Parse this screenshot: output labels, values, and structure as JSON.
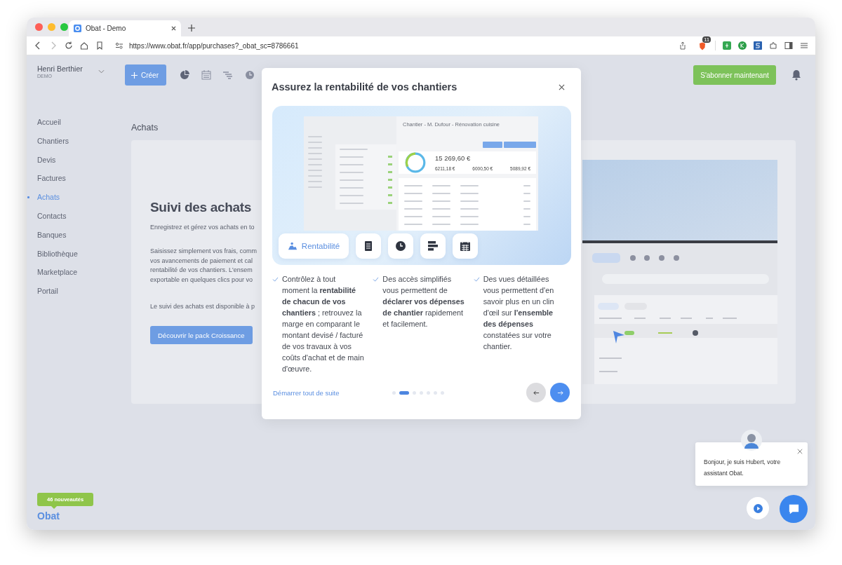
{
  "browser": {
    "tab_title": "Obat - Demo",
    "url": "https://www.obat.fr/app/purchases?_obat_sc=8786661",
    "extension_badge": "11"
  },
  "user": {
    "name": "Henri Berthier",
    "org": "DEMO"
  },
  "create_button": "Créer",
  "subscribe_button": "S'abonner maintenant",
  "sidebar": {
    "items": [
      {
        "label": "Accueil",
        "selected": false
      },
      {
        "label": "Chantiers",
        "selected": false
      },
      {
        "label": "Devis",
        "selected": false
      },
      {
        "label": "Factures",
        "selected": false
      },
      {
        "label": "Achats",
        "selected": true
      },
      {
        "label": "Contacts",
        "selected": false
      },
      {
        "label": "Banques",
        "selected": false
      },
      {
        "label": "Bibliothèque",
        "selected": false
      },
      {
        "label": "Marketplace",
        "selected": false
      },
      {
        "label": "Portail",
        "selected": false
      }
    ],
    "news_badge": "46 nouveautés",
    "logo": "Obat"
  },
  "page": {
    "title": "Achats",
    "heading": "Suivi des achats",
    "subtitle": "Enregistrez et gérez vos achats en to",
    "body_lines": [
      "Saisissez simplement vos frais, comm",
      "vos avancements de paiement et cal",
      "rentabilité de vos chantiers. L'ensem",
      "exportable en quelques clics pour vo"
    ],
    "availability": "Le suivi des achats est disponible à p",
    "cta": "Découvrir le pack Croissance"
  },
  "modal": {
    "title": "Assurez la rentabilité de vos chantiers",
    "preview": {
      "title": "Chantier - M. Dufour - Rénovation cuisine",
      "total": "15 269,60 €",
      "amounts": [
        "6211,18 €",
        "6000,50 €",
        "5089,92 €"
      ]
    },
    "feature_tabs": [
      {
        "label": "Rentabilité",
        "selected": true
      },
      {
        "selected": false
      },
      {
        "selected": false
      },
      {
        "selected": false
      },
      {
        "selected": false
      }
    ],
    "points": [
      "Contrôlez à tout moment la **rentabilité de chacun de vos chantiers** ; retrouvez la marge en comparant le montant devisé / facturé de vos travaux à vos coûts d'achat et de main d'œuvre.",
      "Des accès simplifiés vous permettent de **déclarer vos dépenses de chantier** rapidement et facilement.",
      "Des vues détaillées vous permettent d'en savoir plus en un clin d'œil sur **l'ensemble des dépenses** constatées sur votre chantier."
    ],
    "start_link": "Démarrer tout de suite",
    "pages": [
      {
        "selected": false
      },
      {
        "selected": true
      },
      {
        "selected": false
      },
      {
        "selected": false
      },
      {
        "selected": false
      },
      {
        "selected": false
      },
      {
        "selected": false
      }
    ]
  },
  "chat": {
    "message": "Bonjour, je suis Hubert, votre assistant Obat."
  }
}
